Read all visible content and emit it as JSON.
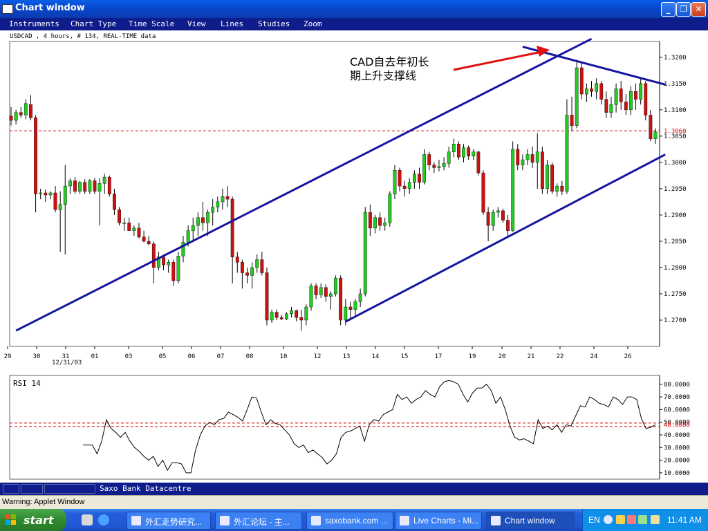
{
  "window": {
    "title": "Chart window"
  },
  "menu": [
    "Instruments",
    "Chart Type",
    "Time Scale",
    "View",
    "Lines",
    "Studies",
    "Zoom"
  ],
  "chart_info": "USDCAD , 4 hours, # 134, REAL-TIME data",
  "annotation": {
    "line1": "CAD自去年初长",
    "line2": "期上升支撑线"
  },
  "chart_data": [
    {
      "type": "candlestick",
      "title": "USDCAD , 4 hours, # 134, REAL-TIME data",
      "ylim": [
        1.265,
        1.323
      ],
      "yticks": [
        "1.3200",
        "1.3150",
        "1.3100",
        "1.3050",
        "1.3000",
        "1.2950",
        "1.2900",
        "1.2850",
        "1.2800",
        "1.2750",
        "1.2700"
      ],
      "current_price": "1.3060",
      "xticks": [
        "29",
        "30",
        "31",
        "01",
        "03",
        "05",
        "06",
        "07",
        "08",
        "10",
        "12",
        "13",
        "14",
        "15",
        "17",
        "19",
        "20",
        "21",
        "22",
        "24",
        "26"
      ],
      "xtick_sub": "12/31/03",
      "colors": {
        "up": "#22cc22",
        "down": "#cc1111",
        "channel": "#1414a0",
        "price_line": "#dd0000"
      },
      "candles": [
        [
          1.3088,
          1.3105,
          1.307,
          1.308
        ],
        [
          1.308,
          1.31,
          1.3072,
          1.3095
        ],
        [
          1.3095,
          1.3105,
          1.3085,
          1.309
        ],
        [
          1.309,
          1.312,
          1.3082,
          1.3112
        ],
        [
          1.311,
          1.3128,
          1.308,
          1.3085
        ],
        [
          1.3085,
          1.309,
          1.2905,
          1.294
        ],
        [
          1.294,
          1.295,
          1.293,
          1.2942
        ],
        [
          1.2942,
          1.2948,
          1.2925,
          1.2938
        ],
        [
          1.2938,
          1.2945,
          1.293,
          1.2942
        ],
        [
          1.2942,
          1.2955,
          1.2905,
          1.291
        ],
        [
          1.291,
          1.2945,
          1.283,
          1.292
        ],
        [
          1.292,
          1.2995,
          1.2825,
          1.2955
        ],
        [
          1.2955,
          1.297,
          1.294,
          1.2965
        ],
        [
          1.2965,
          1.2972,
          1.294,
          1.2945
        ],
        [
          1.2945,
          1.2965,
          1.294,
          1.2962
        ],
        [
          1.2962,
          1.2968,
          1.294,
          1.2945
        ],
        [
          1.2945,
          1.2968,
          1.294,
          1.2965
        ],
        [
          1.2965,
          1.297,
          1.294,
          1.2945
        ],
        [
          1.2945,
          1.297,
          1.288,
          1.296
        ],
        [
          1.296,
          1.2978,
          1.294,
          1.2972
        ],
        [
          1.2972,
          1.2975,
          1.2935,
          1.294
        ],
        [
          1.294,
          1.295,
          1.29,
          1.291
        ],
        [
          1.291,
          1.2915,
          1.288,
          1.2885
        ],
        [
          1.2885,
          1.2895,
          1.287,
          1.2885
        ],
        [
          1.2885,
          1.2895,
          1.287,
          1.287
        ],
        [
          1.287,
          1.288,
          1.286,
          1.2875
        ],
        [
          1.2875,
          1.2885,
          1.2855,
          1.2858
        ],
        [
          1.2858,
          1.287,
          1.2848,
          1.285
        ],
        [
          1.285,
          1.286,
          1.2842,
          1.2845
        ],
        [
          1.2845,
          1.285,
          1.277,
          1.28
        ],
        [
          1.28,
          1.283,
          1.2795,
          1.282
        ],
        [
          1.282,
          1.2825,
          1.2795,
          1.2805
        ],
        [
          1.2805,
          1.2815,
          1.279,
          1.281
        ],
        [
          1.281,
          1.2815,
          1.2765,
          1.2775
        ],
        [
          1.2775,
          1.283,
          1.277,
          1.2822
        ],
        [
          1.2822,
          1.286,
          1.281,
          1.2848
        ],
        [
          1.2848,
          1.288,
          1.284,
          1.287
        ],
        [
          1.287,
          1.2895,
          1.285,
          1.288
        ],
        [
          1.288,
          1.2905,
          1.286,
          1.2895
        ],
        [
          1.2895,
          1.2925,
          1.287,
          1.2885
        ],
        [
          1.2885,
          1.291,
          1.286,
          1.2905
        ],
        [
          1.2905,
          1.293,
          1.288,
          1.2915
        ],
        [
          1.2915,
          1.2935,
          1.2905,
          1.2925
        ],
        [
          1.2925,
          1.295,
          1.291,
          1.2935
        ],
        [
          1.2935,
          1.2955,
          1.2915,
          1.293
        ],
        [
          1.293,
          1.2935,
          1.277,
          1.282
        ],
        [
          1.282,
          1.283,
          1.279,
          1.281
        ],
        [
          1.281,
          1.2815,
          1.276,
          1.279
        ],
        [
          1.279,
          1.28,
          1.277,
          1.2785
        ],
        [
          1.2785,
          1.281,
          1.276,
          1.28
        ],
        [
          1.28,
          1.2825,
          1.279,
          1.2815
        ],
        [
          1.2815,
          1.283,
          1.2785,
          1.279
        ],
        [
          1.279,
          1.28,
          1.269,
          1.27
        ],
        [
          1.27,
          1.272,
          1.2695,
          1.2715
        ],
        [
          1.2715,
          1.272,
          1.27,
          1.2705
        ],
        [
          1.2705,
          1.271,
          1.27,
          1.2702
        ],
        [
          1.2702,
          1.2715,
          1.27,
          1.2712
        ],
        [
          1.2712,
          1.2725,
          1.2705,
          1.2718
        ],
        [
          1.2718,
          1.272,
          1.2698,
          1.2705
        ],
        [
          1.2705,
          1.272,
          1.268,
          1.27
        ],
        [
          1.27,
          1.273,
          1.269,
          1.2725
        ],
        [
          1.2725,
          1.277,
          1.2718,
          1.2765
        ],
        [
          1.2765,
          1.277,
          1.274,
          1.2748
        ],
        [
          1.2748,
          1.277,
          1.2742,
          1.2762
        ],
        [
          1.2762,
          1.2768,
          1.2735,
          1.2745
        ],
        [
          1.2745,
          1.2755,
          1.272,
          1.275
        ],
        [
          1.275,
          1.2785,
          1.2745,
          1.278
        ],
        [
          1.278,
          1.2785,
          1.269,
          1.27
        ],
        [
          1.27,
          1.274,
          1.269,
          1.2725
        ],
        [
          1.2725,
          1.2735,
          1.27,
          1.272
        ],
        [
          1.272,
          1.274,
          1.2705,
          1.2735
        ],
        [
          1.2735,
          1.276,
          1.2725,
          1.275
        ],
        [
          1.275,
          1.2915,
          1.2745,
          1.2905
        ],
        [
          1.2905,
          1.292,
          1.286,
          1.2875
        ],
        [
          1.2875,
          1.29,
          1.2865,
          1.2895
        ],
        [
          1.2895,
          1.2905,
          1.287,
          1.288
        ],
        [
          1.288,
          1.2895,
          1.287,
          1.2885
        ],
        [
          1.2885,
          1.2945,
          1.2878,
          1.294
        ],
        [
          1.294,
          1.2995,
          1.293,
          1.2985
        ],
        [
          1.2985,
          1.299,
          1.2945,
          1.2955
        ],
        [
          1.2955,
          1.2965,
          1.2935,
          1.295
        ],
        [
          1.295,
          1.297,
          1.294,
          1.2962
        ],
        [
          1.2962,
          1.2985,
          1.295,
          1.2978
        ],
        [
          1.2978,
          1.299,
          1.295,
          1.2962
        ],
        [
          1.2962,
          1.3025,
          1.2958,
          1.3015
        ],
        [
          1.3015,
          1.302,
          1.2985,
          1.2995
        ],
        [
          1.2995,
          1.3,
          1.298,
          1.299
        ],
        [
          1.299,
          1.3005,
          1.2983,
          1.2992
        ],
        [
          1.2992,
          1.301,
          1.2985,
          1.2998
        ],
        [
          1.2998,
          1.303,
          1.299,
          1.302
        ],
        [
          1.302,
          1.3045,
          1.301,
          1.3035
        ],
        [
          1.3035,
          1.304,
          1.3005,
          1.301
        ],
        [
          1.301,
          1.3035,
          1.3,
          1.3028
        ],
        [
          1.3028,
          1.3032,
          1.3005,
          1.3012
        ],
        [
          1.3012,
          1.3025,
          1.3005,
          1.302
        ],
        [
          1.302,
          1.3022,
          1.2975,
          1.298
        ],
        [
          1.298,
          1.2985,
          1.29,
          1.2905
        ],
        [
          1.2905,
          1.2915,
          1.285,
          1.288
        ],
        [
          1.288,
          1.291,
          1.287,
          1.2905
        ],
        [
          1.2905,
          1.2915,
          1.2895,
          1.2908
        ],
        [
          1.2908,
          1.2912,
          1.2885,
          1.289
        ],
        [
          1.289,
          1.29,
          1.286,
          1.287
        ],
        [
          1.287,
          1.304,
          1.2868,
          1.3025
        ],
        [
          1.3025,
          1.3035,
          1.2985,
          1.2995
        ],
        [
          1.2995,
          1.3015,
          1.2985,
          1.3005
        ],
        [
          1.3005,
          1.3025,
          1.2995,
          1.3015
        ],
        [
          1.3015,
          1.303,
          1.299,
          1.3
        ],
        [
          1.3,
          1.3055,
          1.295,
          1.302
        ],
        [
          1.302,
          1.303,
          1.294,
          1.295
        ],
        [
          1.295,
          1.3005,
          1.294,
          1.2995
        ],
        [
          1.2995,
          1.3,
          1.294,
          1.2945
        ],
        [
          1.2945,
          1.296,
          1.2935,
          1.2955
        ],
        [
          1.2955,
          1.2965,
          1.2938,
          1.2945
        ],
        [
          1.2945,
          1.312,
          1.294,
          1.309
        ],
        [
          1.309,
          1.3125,
          1.306,
          1.307
        ],
        [
          1.307,
          1.3195,
          1.3065,
          1.318
        ],
        [
          1.318,
          1.319,
          1.312,
          1.313
        ],
        [
          1.313,
          1.315,
          1.3115,
          1.314
        ],
        [
          1.314,
          1.3155,
          1.3125,
          1.3135
        ],
        [
          1.3135,
          1.316,
          1.312,
          1.315
        ],
        [
          1.315,
          1.3155,
          1.311,
          1.312
        ],
        [
          1.312,
          1.3135,
          1.3085,
          1.3095
        ],
        [
          1.3095,
          1.3125,
          1.3085,
          1.311
        ],
        [
          1.311,
          1.315,
          1.3095,
          1.314
        ],
        [
          1.314,
          1.3155,
          1.31,
          1.3115
        ],
        [
          1.3115,
          1.313,
          1.309,
          1.31
        ],
        [
          1.31,
          1.3145,
          1.309,
          1.3135
        ],
        [
          1.3135,
          1.315,
          1.31,
          1.312
        ],
        [
          1.312,
          1.316,
          1.311,
          1.315
        ],
        [
          1.315,
          1.3155,
          1.308,
          1.309
        ],
        [
          1.309,
          1.31,
          1.304,
          1.3045
        ],
        [
          1.3045,
          1.3065,
          1.3035,
          1.3058
        ]
      ],
      "lines": [
        {
          "name": "upper-channel",
          "from": [
            1,
            1.268
          ],
          "to": [
            118,
            1.3235
          ]
        },
        {
          "name": "lower-channel",
          "from": [
            68,
            1.2697
          ],
          "to": [
            133,
            1.3015
          ]
        },
        {
          "name": "resistance-line",
          "from": [
            104,
            1.322
          ],
          "to": [
            133,
            1.3148
          ]
        }
      ]
    },
    {
      "type": "line",
      "title": "RSI 14",
      "ylim": [
        5,
        87
      ],
      "yticks": [
        "80.0000",
        "70.0000",
        "60.0000",
        "50.0000",
        "40.0000",
        "30.0000",
        "20.0000",
        "10.0000"
      ],
      "level": "48.0000",
      "series": [
        {
          "values": [
            32,
            32,
            32,
            25,
            35,
            52,
            45,
            42,
            38,
            42,
            35,
            30,
            27,
            23,
            20,
            23,
            15,
            20,
            12,
            18,
            18,
            17,
            10,
            10,
            28,
            40,
            47,
            50,
            48,
            52,
            53,
            58,
            56,
            54,
            51,
            60,
            70,
            69,
            58,
            48,
            52,
            49,
            48,
            44,
            40,
            33,
            30,
            32,
            26,
            28,
            25,
            22,
            17,
            20,
            25,
            38,
            42,
            43,
            45,
            47,
            35,
            48,
            52,
            51,
            56,
            58,
            60,
            72,
            68,
            70,
            65,
            68,
            70,
            75,
            72,
            70,
            78,
            82,
            83,
            82,
            80,
            72,
            66,
            73,
            77,
            77,
            80,
            75,
            65,
            70,
            60,
            47,
            38,
            36,
            37,
            35,
            33,
            52,
            45,
            47,
            44,
            48,
            42,
            48,
            47,
            55,
            63,
            62,
            70,
            68,
            65,
            64,
            62,
            70,
            68,
            64,
            70,
            70,
            68,
            53,
            45,
            46,
            48
          ]
        }
      ]
    }
  ],
  "status_bar": {
    "source": "Saxo Bank Datacentre"
  },
  "warning": "Warning: Applet Window",
  "taskbar": {
    "start_label": "start",
    "buttons": [
      "外汇走势研究...",
      "外汇论坛 - 主...",
      "saxobank.com ...",
      "Live Charts - Mi...",
      "Chart window"
    ],
    "lang": "EN",
    "clock": "11:41 AM"
  }
}
